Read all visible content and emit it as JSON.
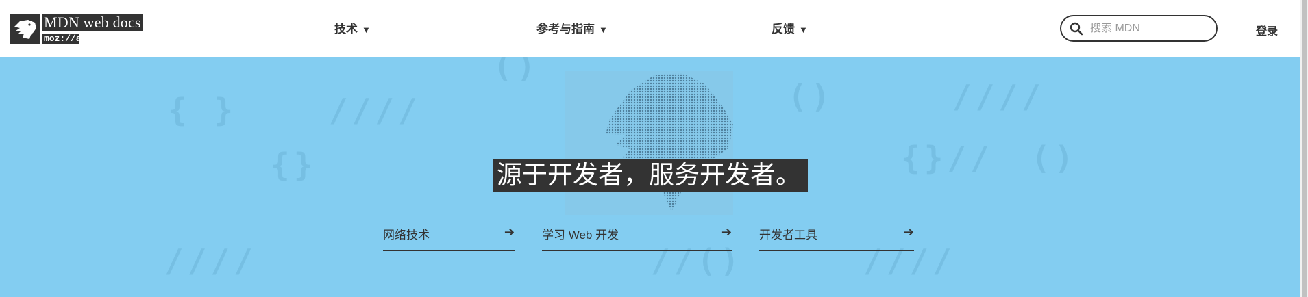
{
  "logo": {
    "title": "MDN web docs",
    "subtitle": "moz://a"
  },
  "nav": {
    "items": [
      {
        "label": "技术"
      },
      {
        "label": "参考与指南"
      },
      {
        "label": "反馈"
      }
    ],
    "arrow": "▼"
  },
  "search": {
    "placeholder": "搜索 MDN",
    "value": ""
  },
  "header": {
    "login_label": "登录"
  },
  "hero": {
    "tagline": "源于开发者，服务开发者。",
    "links": [
      {
        "label": "网络技术"
      },
      {
        "label": "学习 Web 开发"
      },
      {
        "label": "开发者工具"
      }
    ],
    "link_arrow": "➔"
  },
  "colors": {
    "hero_background": "#83cdf1",
    "text": "#333333"
  }
}
